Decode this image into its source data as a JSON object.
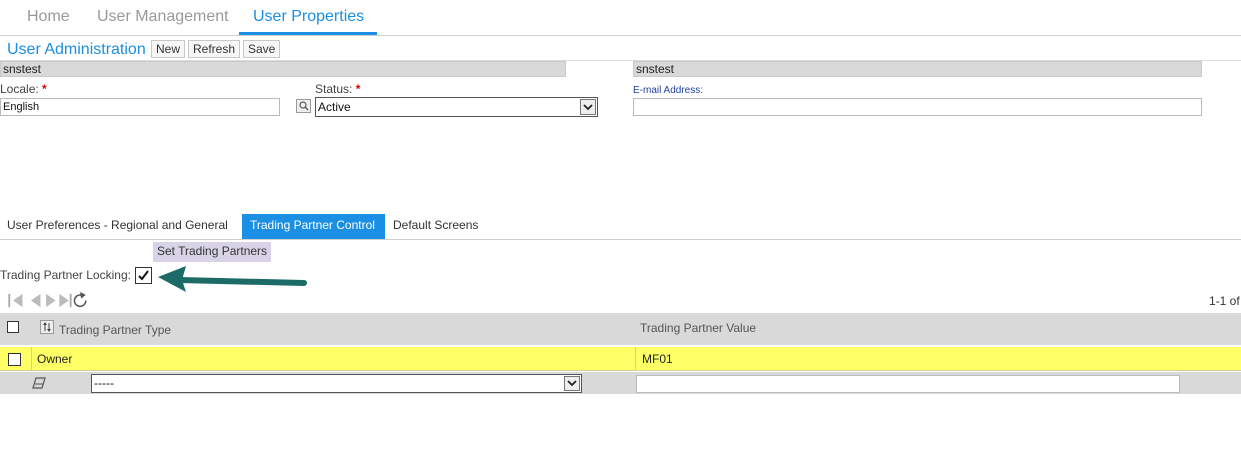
{
  "top_tabs": [
    {
      "label": "Home"
    },
    {
      "label": "User Management"
    },
    {
      "label": "User Properties"
    }
  ],
  "page_title": "User Administration",
  "toolbar": {
    "new_label": "New",
    "refresh_label": "Refresh",
    "save_label": "Save"
  },
  "user": {
    "name_left": "snstest",
    "name_right": "snstest"
  },
  "form": {
    "locale_label": "Locale:",
    "locale_value": "English",
    "status_label": "Status:",
    "status_value": "Active",
    "email_label": "E-mail Address:",
    "email_value": "",
    "required_mark": "*"
  },
  "sub_tabs": [
    {
      "label": "User Preferences - Regional and General"
    },
    {
      "label": "Trading Partner Control"
    },
    {
      "label": "Default Screens"
    }
  ],
  "set_trading_partners_label": "Set Trading Partners",
  "tp_locking": {
    "label": "Trading Partner Locking:",
    "checked": true
  },
  "pager": {
    "count_text": "1-1 of"
  },
  "grid": {
    "columns": [
      "Trading Partner Type",
      "Trading Partner Value"
    ],
    "rows": [
      {
        "type": "Owner",
        "value": "MF01"
      }
    ],
    "new_row": {
      "type_value": "-----",
      "value_value": ""
    }
  },
  "colors": {
    "accent": "#1a8fe3",
    "highlight_row": "#ffff66",
    "arrow": "#1c6b66"
  }
}
